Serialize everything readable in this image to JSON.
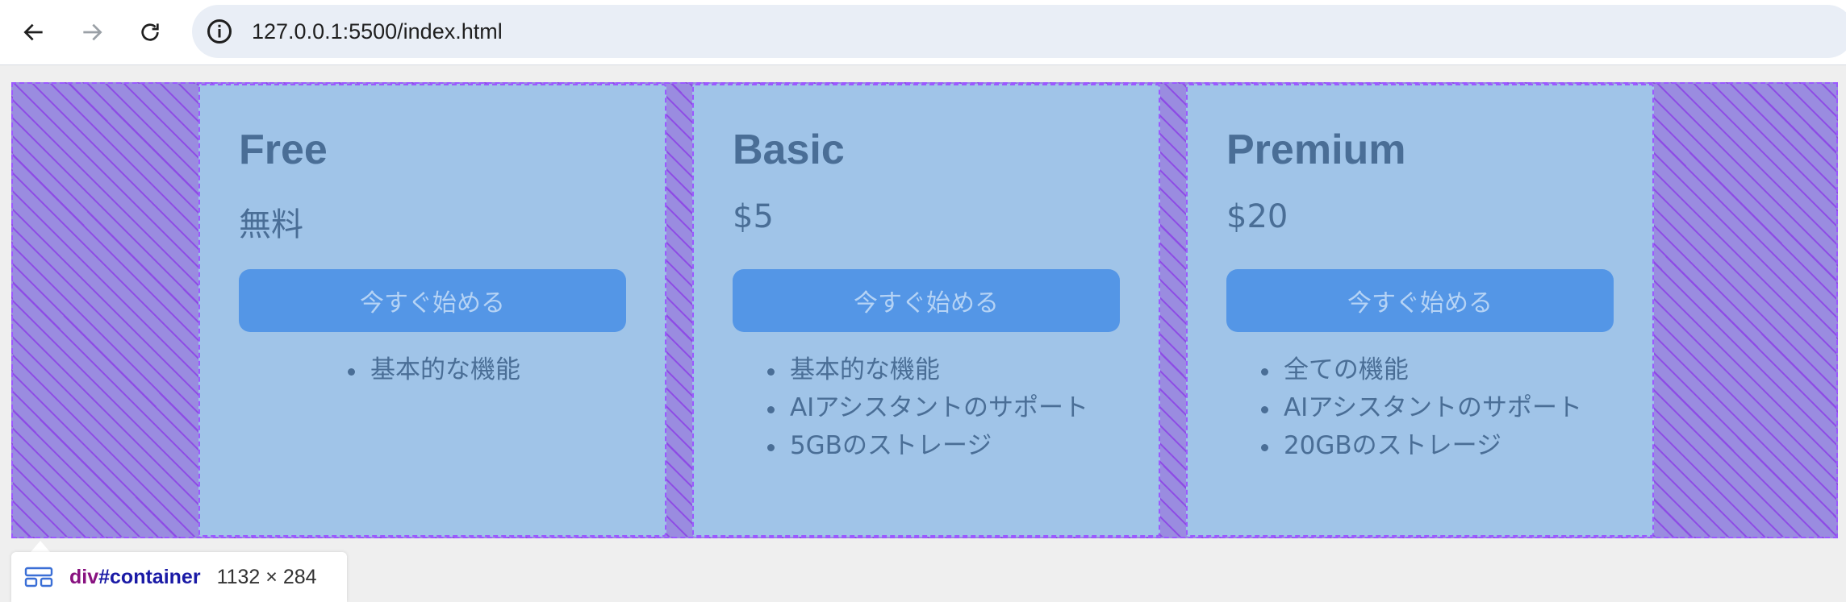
{
  "browser": {
    "url": "127.0.0.1:5500/index.html",
    "icons": {
      "back": "arrow-left-icon",
      "forward": "arrow-right-icon",
      "reload": "reload-icon",
      "info": "info-icon"
    }
  },
  "plans": [
    {
      "name": "Free",
      "price": "無料",
      "cta": "今すぐ始める",
      "features": [
        "基本的な機能"
      ]
    },
    {
      "name": "Basic",
      "price": "$5",
      "cta": "今すぐ始める",
      "features": [
        "基本的な機能",
        "AIアシスタントのサポート",
        "5GBのストレージ"
      ]
    },
    {
      "name": "Premium",
      "price": "$20",
      "cta": "今すぐ始める",
      "features": [
        "全ての機能",
        "AIアシスタントのサポート",
        "20GBのストレージ"
      ]
    }
  ],
  "inspector": {
    "tag": "div",
    "id": "#container",
    "dimensions": "1132 × 284"
  },
  "colors": {
    "card_bg": "#a0c4e8",
    "button_bg": "#5496e6",
    "text": "#4a6e96",
    "overlay": "#9a8ce0"
  }
}
